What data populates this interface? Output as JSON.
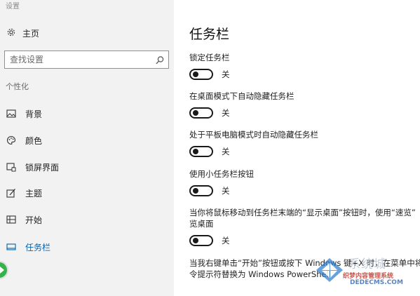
{
  "app": {
    "title": "设置"
  },
  "sidebar": {
    "home_label": "主页",
    "search_placeholder": "查找设置",
    "section_label": "个性化",
    "items": [
      {
        "label": "背景",
        "icon": "picture-icon"
      },
      {
        "label": "颜色",
        "icon": "palette-icon"
      },
      {
        "label": "锁屏界面",
        "icon": "lock-screen-icon"
      },
      {
        "label": "主题",
        "icon": "theme-icon"
      },
      {
        "label": "开始",
        "icon": "start-menu-icon"
      },
      {
        "label": "任务栏",
        "icon": "taskbar-icon",
        "selected": true
      }
    ]
  },
  "main": {
    "title": "任务栏",
    "settings": [
      {
        "label": "锁定任务栏",
        "state": "关"
      },
      {
        "label": "在桌面模式下自动隐藏任务栏",
        "state": "关"
      },
      {
        "label": "处于平板电脑模式时自动隐藏任务栏",
        "state": "关"
      },
      {
        "label": "使用小任务栏按钮",
        "state": "关"
      },
      {
        "label": "当你将鼠标移动到任务栏末端的“显示桌面”按钮时，使用“速览”",
        "label2": "览桌面",
        "state": "关"
      },
      {
        "label": "当我右键单击“开始”按钮或按下 Windows 键+X 时，在菜单中将",
        "label2": "令提示符替换为 Windows PowerShell"
      }
    ]
  },
  "watermark": {
    "site": "系统城",
    "tagline": "织梦内容管理系统",
    "url": "DEDECMS.COM",
    "sub_url": "xitongcheng.com"
  },
  "colors": {
    "accent": "#0063b1",
    "sidebar_bg": "#f2f2f2",
    "toggle_off": "#1a1a1a",
    "float_button": "#35b34a"
  }
}
